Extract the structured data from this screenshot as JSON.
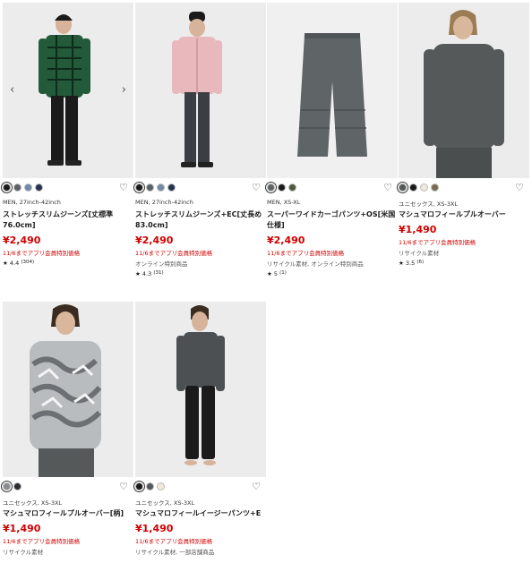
{
  "products": [
    {
      "meta": "MEN, 27inch-42inch",
      "name": "ストレッチスリムジーンズ[丈標準76.0cm]",
      "price": "¥2,490",
      "promo": "11/6までアプリ会員特別価格",
      "sub": "",
      "rating": "4.4",
      "reviews": "(304)",
      "swatches": [
        "#1b1b1b",
        "#5a6068",
        "#6f8aa8",
        "#24344e"
      ],
      "nav": {
        "prev": "‹",
        "next": "›"
      }
    },
    {
      "meta": "MEN, 27inch-42inch",
      "name": "ストレッチスリムジーンズ+EC[丈長め83.0cm]",
      "price": "¥2,490",
      "promo": "11/6までアプリ会員特別価格",
      "sub": "オンライン特別商品",
      "rating": "4.3",
      "reviews": "(31)",
      "swatches": [
        "#1b1b1b",
        "#5a6068",
        "#6f8aa8",
        "#24344e"
      ]
    },
    {
      "meta": "MEN, XS-XL",
      "name": "スーパーワイドカーゴパンツ+OS[米国仕様]",
      "price": "¥2,490",
      "promo": "11/6までアプリ会員特別価格",
      "sub": "リサイクル素材, オンライン特別商品",
      "rating": "5",
      "reviews": "(1)",
      "swatches": [
        "#5f6466",
        "#1b1b1b",
        "#4d5a3c"
      ]
    },
    {
      "meta": "ユニセックス, XS-3XL",
      "name": "マシュマロフィールプルオーバー",
      "price": "¥1,490",
      "promo": "11/6までアプリ会員特別価格",
      "sub": "リサイクル素材",
      "rating": "3.5",
      "reviews": "(6)",
      "swatches": [
        "#55595a",
        "#1b1b1b",
        "#efe9dc",
        "#7a6a4f"
      ]
    },
    {
      "meta": "ユニセックス, XS-3XL",
      "name": "マシュマロフィールプルオーバー[柄]",
      "price": "¥1,490",
      "promo": "11/6までアプリ会員特別価格",
      "sub": "リサイクル素材",
      "rating": "",
      "reviews": "",
      "swatches": [
        "#8a8d90",
        "#2b2d30"
      ]
    },
    {
      "meta": "ユニセックス, XS-3XL",
      "name": "マシュマロフィールイージーパンツ+E",
      "price": "¥1,490",
      "promo": "11/6までアプリ会員特別価格",
      "sub": "リサイクル素材, 一部店舗商品",
      "rating": "",
      "reviews": "",
      "swatches": [
        "#1b1b1b",
        "#55595a",
        "#efe9dc"
      ]
    }
  ],
  "icons": {
    "favorite": "heart-outline",
    "star": "★"
  },
  "colors": {
    "price": "#d00000",
    "promo": "#d00000"
  }
}
